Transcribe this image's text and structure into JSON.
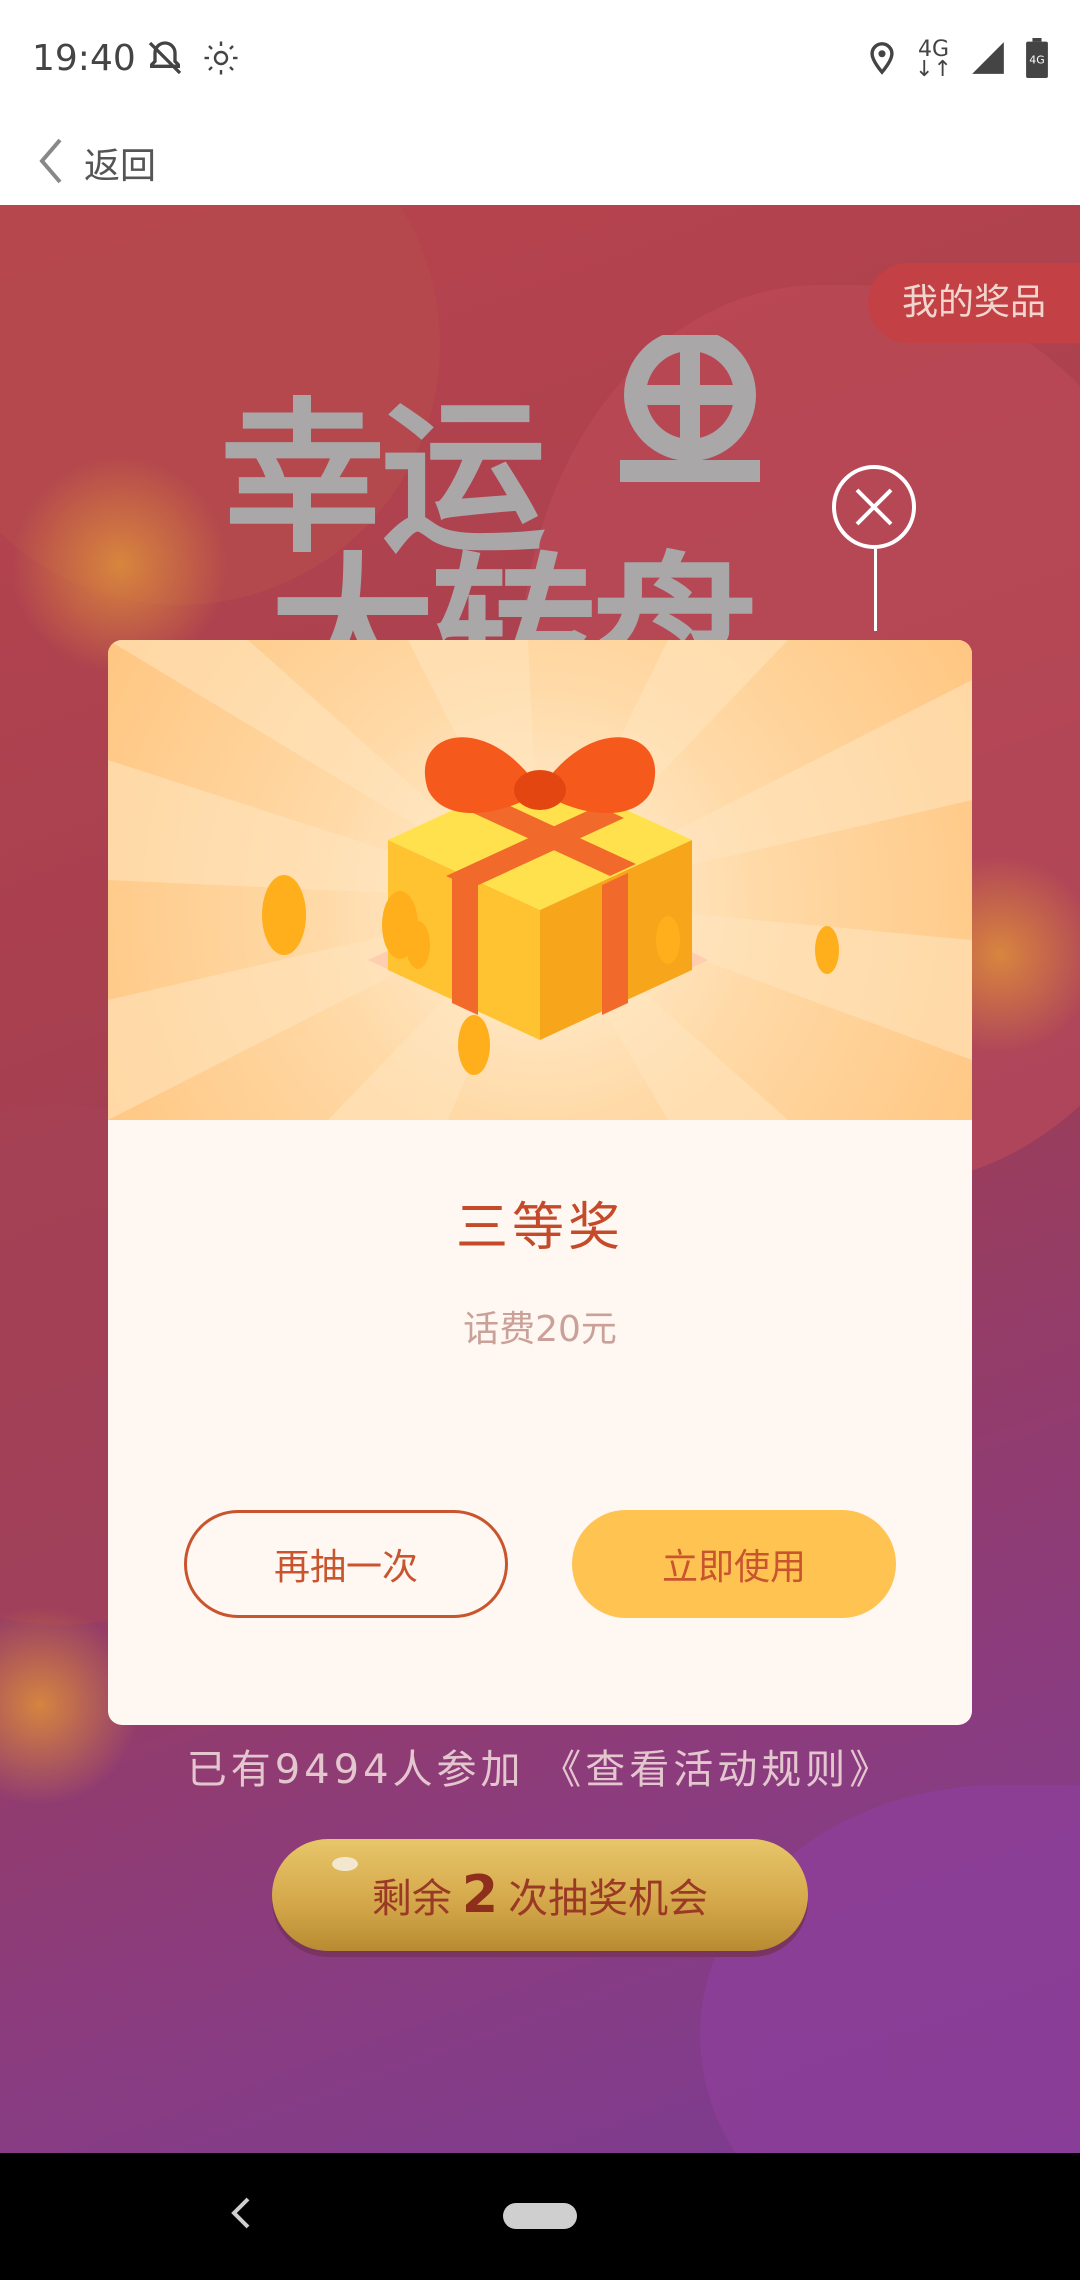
{
  "status_bar": {
    "time": "19:40",
    "network": "4G",
    "icons": [
      "bell-off-icon",
      "brightness-icon",
      "location-icon",
      "network-4g-icon",
      "signal-icon",
      "battery-icon"
    ]
  },
  "nav": {
    "back_label": "返回"
  },
  "page": {
    "my_prizes_label": "我的奖品",
    "title_line1": "幸运",
    "title_line2": "大转盘",
    "participants_text": "已有9494人参加 《查看活动规则》",
    "remain_prefix": "剩余",
    "remain_count": "2",
    "remain_suffix": "次抽奖机会"
  },
  "modal": {
    "prize_title": "三等奖",
    "prize_desc": "话费20元",
    "draw_again_label": "再抽一次",
    "use_now_label": "立即使用"
  },
  "colors": {
    "accent": "#c8552e",
    "button_gold": "#ffc352",
    "bg_top": "#b8444e",
    "bg_bottom": "#7a3b93"
  }
}
